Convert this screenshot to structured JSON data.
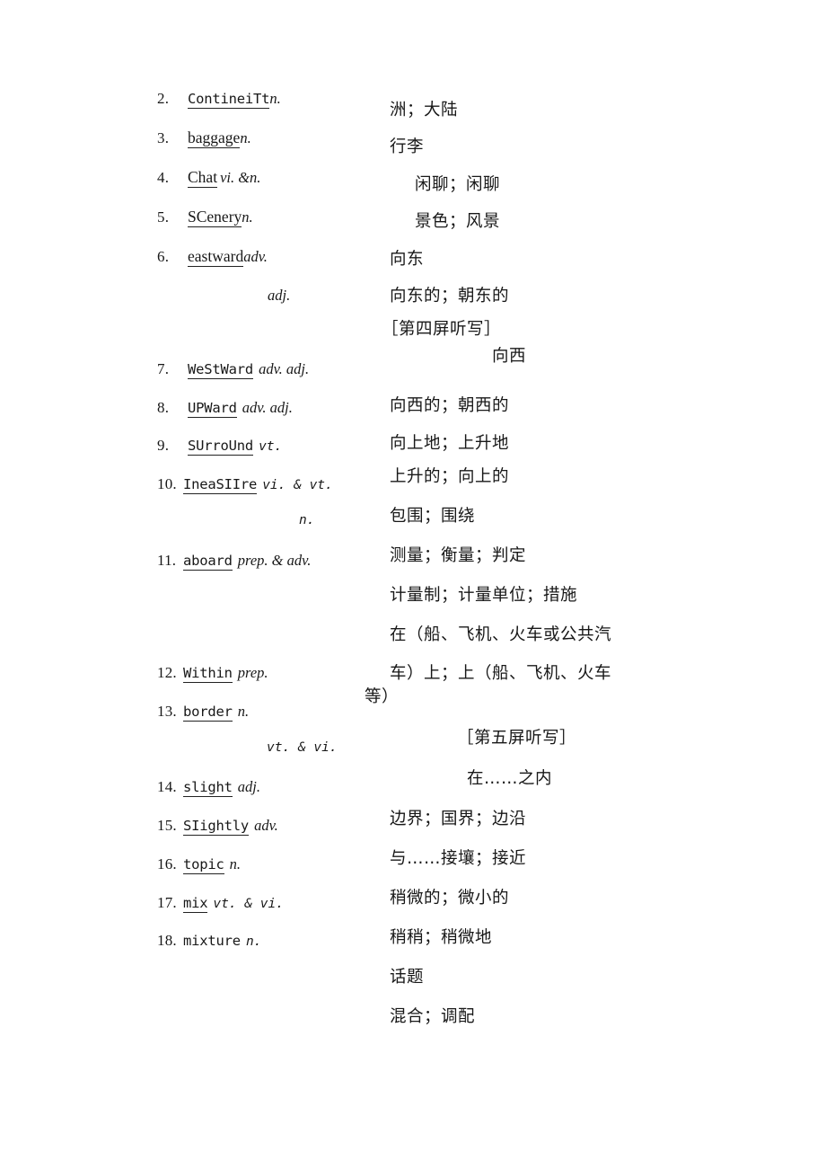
{
  "document": {
    "type": "vocabulary-dictation-worksheet",
    "page_background": "#ffffff",
    "text_color": "#181818"
  },
  "section_headers": [
    {
      "label": "［第四屏听写］"
    },
    {
      "label": "［第五屏听写］"
    }
  ],
  "entries": [
    {
      "num": "2.",
      "word": "ContineiTt",
      "pos": "n."
    },
    {
      "num": "3.",
      "word": "baggage",
      "pos": "n."
    },
    {
      "num": "4.",
      "word": "Chat",
      "pos": "vi. &n."
    },
    {
      "num": "5.",
      "word": "SCenery",
      "pos": "n."
    },
    {
      "num": "6.",
      "word": "eastward",
      "pos": "adv."
    },
    {
      "num": "7.",
      "word": "WeStWard",
      "pos": "adv.  adj."
    },
    {
      "num": "8.",
      "word": "UPWard",
      "pos": "adv.  adj."
    },
    {
      "num": "9.",
      "word": "SUrroUnd",
      "pos": "vt."
    },
    {
      "num": "10.",
      "word": "IneaSIIre",
      "pos": "vi. & vt."
    },
    {
      "num": "11.",
      "word": "aboard",
      "pos": "prep. & adv."
    },
    {
      "num": "12.",
      "word": "Within",
      "pos": "prep."
    },
    {
      "num": "13.",
      "word": "border",
      "pos": "n."
    },
    {
      "num": "14.",
      "word": "slight",
      "pos": "adj."
    },
    {
      "num": "15.",
      "word": "SIightly",
      "pos": "adv."
    },
    {
      "num": "16.",
      "word": "topic",
      "pos": "n."
    },
    {
      "num": "17.",
      "word": "mix",
      "pos": "vt. & vi."
    },
    {
      "num": "18.",
      "word": "mixture",
      "pos": "n."
    }
  ],
  "pos_continuations": [
    {
      "label": "adj."
    },
    {
      "label": "n."
    },
    {
      "label": "vt. & vi."
    }
  ],
  "translations": [
    {
      "text": "洲；大陆"
    },
    {
      "text": "行李"
    },
    {
      "text": "闲聊；闲聊"
    },
    {
      "text": "景色；风景"
    },
    {
      "text": "向东"
    },
    {
      "text": "向东的；朝东的"
    },
    {
      "text": "向西"
    },
    {
      "text": "向西的；朝西的"
    },
    {
      "text": "向上地；上升地"
    },
    {
      "text": "上升的；向上的"
    },
    {
      "text": "包围；围绕"
    },
    {
      "text": "测量；衡量；判定"
    },
    {
      "text": "计量制；计量单位；措施"
    },
    {
      "text": "在（船、飞机、火车或公共汽"
    },
    {
      "text": "车）上；上（船、飞机、火车"
    },
    {
      "text": "等）"
    },
    {
      "text": "在……之内"
    },
    {
      "text": "边界；国界；边沿"
    },
    {
      "text": "与……接壤；接近"
    },
    {
      "text": "稍微的；微小的"
    },
    {
      "text": "稍稍；稍微地"
    },
    {
      "text": "话题"
    },
    {
      "text": "混合；调配"
    }
  ]
}
